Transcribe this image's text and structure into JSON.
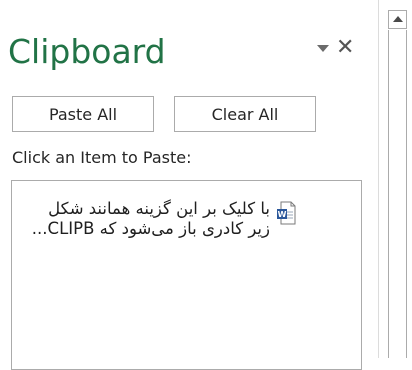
{
  "pane": {
    "title": "Clipboard",
    "close_glyph": "✕",
    "paste_all_label": "Paste All",
    "clear_all_label": "Clear All",
    "hint": "Click an Item to Paste:",
    "accent_color": "#217346"
  },
  "clipboard_items": [
    {
      "icon": "word-document-icon",
      "text": "با کلیک بر این گزینه همانند شکل زیر کادری باز می‌شود که CLIPB..."
    }
  ]
}
